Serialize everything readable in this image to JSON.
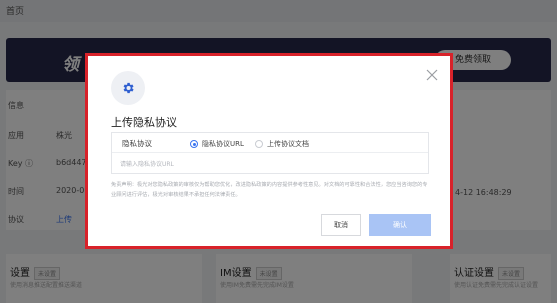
{
  "background": {
    "topbar_title": "首页",
    "banner_text": "领",
    "banner_button": "免费领取",
    "section_label": "信息",
    "rows": [
      {
        "key": "应用",
        "value": "株光"
      },
      {
        "key": "Key ⓘ",
        "value": "b6d4471"
      },
      {
        "key": "时间",
        "value": "2020-06"
      },
      {
        "key": "协议",
        "value": "上传"
      }
    ],
    "right_date": "4-12 16:48:29",
    "cards": [
      {
        "title": "设置",
        "tag": "未设置",
        "desc": "使用消息推送配置推送渠道"
      },
      {
        "title": "IM设置",
        "tag": "未设置",
        "desc": "使用IM免费需先完成IM设置"
      },
      {
        "title": "认证设置",
        "tag": "未设置",
        "desc": "使用认证免费需先完成认证设置"
      }
    ]
  },
  "modal": {
    "icon": "gear-icon",
    "title": "上传隐私协议",
    "field_label": "隐私协议",
    "options": [
      {
        "label": "隐私协议URL",
        "checked": true
      },
      {
        "label": "上传协议文档",
        "checked": false
      }
    ],
    "url_placeholder": "请输入隐私协议URL",
    "disclaimer": "免责声明：极光对您隐私政策的审核仅为帮助您优化，改进隐私政策的内容提供参考性意见。对文档的可靠性和合法性，您应当咨询您的专业顾问进行评估，极光对审核结果不承担任何法律责任。",
    "cancel_label": "取消",
    "confirm_label": "确认"
  },
  "colors": {
    "accent": "#3a74f0",
    "highlight_border": "#d8222a",
    "banner": "#26284a"
  }
}
